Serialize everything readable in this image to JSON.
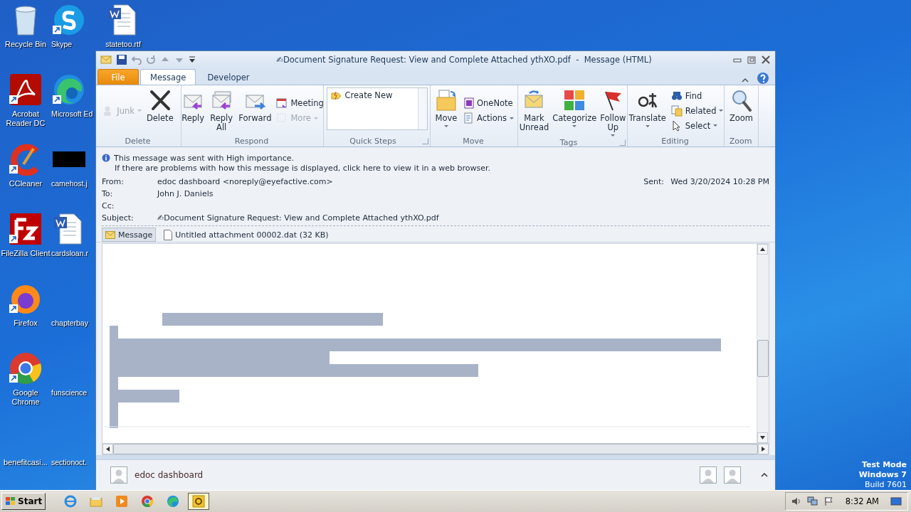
{
  "desktop_icons": [
    {
      "label": "Recycle Bin",
      "shortcut": false
    },
    {
      "label": "Acrobat Reader DC",
      "shortcut": true
    },
    {
      "label": "CCleaner",
      "shortcut": true
    },
    {
      "label": "FileZilla Client",
      "shortcut": true
    },
    {
      "label": "Firefox",
      "shortcut": true
    },
    {
      "label": "Google Chrome",
      "shortcut": true
    },
    {
      "label": "benefitcasi...",
      "shortcut": false
    },
    {
      "label": "Skype",
      "shortcut": true
    },
    {
      "label": "Microsoft Ed",
      "shortcut": true
    },
    {
      "label": "camehost.j",
      "shortcut": false
    },
    {
      "label": "cardsloan.r",
      "shortcut": false
    },
    {
      "label": "chapterbay",
      "shortcut": false
    },
    {
      "label": "funscience",
      "shortcut": false
    },
    {
      "label": "sectionoct.",
      "shortcut": false
    },
    {
      "label": "statetoo.rtf",
      "shortcut": false
    }
  ],
  "window": {
    "title": "✍Document Signature Request: View and Complete Attached ythXO.pdf  -  Message (HTML)"
  },
  "ribbon_tabs": [
    {
      "label": "File",
      "kind": "file",
      "selected": false
    },
    {
      "label": "Message",
      "kind": "tab",
      "selected": true
    },
    {
      "label": "Developer",
      "kind": "tab",
      "selected": false
    }
  ],
  "ribbon_groups": [
    {
      "label": "Delete",
      "launcher": false,
      "buttons": [
        {
          "label": "Junk",
          "kind": "small",
          "dropdown": true,
          "disabled": true
        },
        {
          "label": "Delete",
          "kind": "large",
          "dropdown": false,
          "disabled": false
        }
      ]
    },
    {
      "label": "Respond",
      "launcher": false,
      "buttons": [
        {
          "label": "Reply",
          "kind": "large",
          "dropdown": false,
          "disabled": false
        },
        {
          "label": "Reply All",
          "kind": "large",
          "dropdown": false,
          "disabled": false
        },
        {
          "label": "Forward",
          "kind": "large",
          "dropdown": false,
          "disabled": false
        },
        {
          "label": "Meeting",
          "kind": "small",
          "dropdown": false,
          "disabled": false
        },
        {
          "label": "More",
          "kind": "small",
          "dropdown": true,
          "disabled": true
        }
      ]
    },
    {
      "label": "Quick Steps",
      "launcher": true,
      "buttons": [
        {
          "label": "Create New",
          "kind": "gallery",
          "dropdown": false,
          "disabled": false
        }
      ]
    },
    {
      "label": "Move",
      "launcher": false,
      "buttons": [
        {
          "label": "Move",
          "kind": "large",
          "dropdown": true,
          "disabled": false
        },
        {
          "label": "OneNote",
          "kind": "small",
          "dropdown": false,
          "disabled": false
        },
        {
          "label": "Actions",
          "kind": "small",
          "dropdown": true,
          "disabled": false
        }
      ]
    },
    {
      "label": "Tags",
      "launcher": true,
      "buttons": [
        {
          "label": "Mark Unread",
          "kind": "large",
          "dropdown": false,
          "disabled": false
        },
        {
          "label": "Categorize",
          "kind": "large",
          "dropdown": true,
          "disabled": false
        },
        {
          "label": "Follow Up",
          "kind": "large",
          "dropdown": true,
          "disabled": false
        }
      ]
    },
    {
      "label": "Editing",
      "launcher": false,
      "buttons": [
        {
          "label": "Translate",
          "kind": "large",
          "dropdown": true,
          "disabled": false
        },
        {
          "label": "Find",
          "kind": "small",
          "dropdown": false,
          "disabled": false
        },
        {
          "label": "Related",
          "kind": "small",
          "dropdown": true,
          "disabled": false
        },
        {
          "label": "Select",
          "kind": "small",
          "dropdown": true,
          "disabled": false
        }
      ]
    },
    {
      "label": "Zoom",
      "launcher": false,
      "buttons": [
        {
          "label": "Zoom",
          "kind": "large",
          "dropdown": false,
          "disabled": false
        }
      ]
    }
  ],
  "notices": [
    "This message was sent with High importance.",
    "If there are problems with how this message is displayed, click here to view it in a web browser."
  ],
  "fields": [
    {
      "label": "From:",
      "value": "edoc dashboard <noreply@eyefactive.com>"
    },
    {
      "label": "To:",
      "value": "John J. Daniels"
    },
    {
      "label": "Cc:"
    },
    {
      "label": "Subject:",
      "value": "✍Document Signature Request: View and Complete Attached ythXO.pdf"
    }
  ],
  "sent": {
    "label": "Sent:",
    "value": "Wed 3/20/2024 10:28 PM"
  },
  "attachments": [
    {
      "label": "Message",
      "kind": "message",
      "selected": true
    },
    {
      "label": "Untitled attachment 00002.dat (32 KB)",
      "kind": "file",
      "selected": false
    }
  ],
  "people_pane": {
    "name": "edoc dashboard"
  },
  "test_mode_notice": [
    "Test Mode",
    "Windows 7",
    "Build 7601"
  ],
  "taskbar": {
    "start": "Start",
    "apps": [
      {
        "selected": false
      },
      {
        "selected": false
      },
      {
        "selected": false
      },
      {
        "selected": false
      },
      {
        "selected": false
      },
      {
        "selected": true
      }
    ],
    "clock": "8:32 AM"
  }
}
